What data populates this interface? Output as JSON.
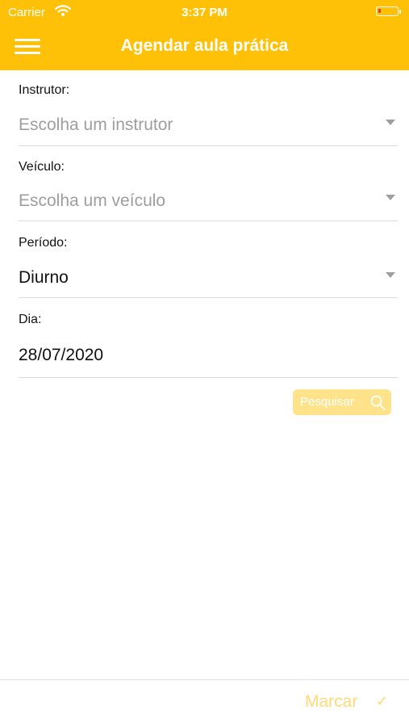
{
  "status_bar": {
    "carrier": "Carrier",
    "time": "3:37 PM"
  },
  "header": {
    "title": "Agendar aula prática"
  },
  "form": {
    "instrutor": {
      "label": "Instrutor:",
      "placeholder": "Escolha um instrutor"
    },
    "veiculo": {
      "label": "Veículo:",
      "placeholder": "Escolha um veículo"
    },
    "periodo": {
      "label": "Período:",
      "value": "Diurno"
    },
    "dia": {
      "label": "Dia:",
      "value": "28/07/2020"
    }
  },
  "search_button": {
    "label": "Pesquisar"
  },
  "footer": {
    "action_label": "Marcar",
    "check_glyph": "✓"
  },
  "colors": {
    "accent": "#FFC107",
    "accent_disabled": "#FFE38A",
    "placeholder": "#9e9e9e"
  },
  "icons": [
    "menu-icon",
    "wifi-icon",
    "battery-icon",
    "dropdown-caret-icon",
    "search-icon",
    "check-icon"
  ]
}
